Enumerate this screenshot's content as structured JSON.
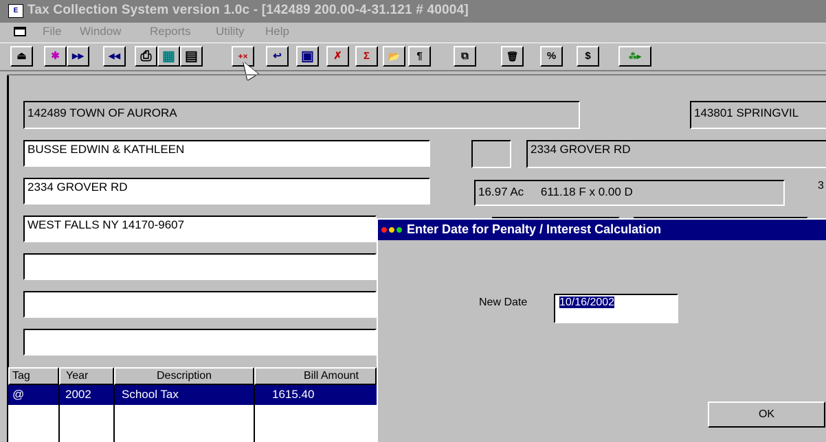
{
  "window": {
    "title": "Tax Collection System version 1.0c - [142489 200.00-4-31.121 # 40004]",
    "icon_label": "E"
  },
  "menu": {
    "items": [
      "File",
      "Window",
      "Reports",
      "Utility",
      "Help"
    ]
  },
  "toolbar": {
    "buttons": [
      {
        "icon": "open-icon",
        "glyph": "⏏"
      },
      {
        "icon": "magic-wand-icon",
        "glyph": "✱"
      },
      {
        "icon": "next-record-icon",
        "glyph": "▶▶"
      },
      {
        "icon": "previous-record-icon",
        "glyph": "◀◀"
      },
      {
        "icon": "print-icon",
        "glyph": "⎙"
      },
      {
        "icon": "grid-icon",
        "glyph": "▦"
      },
      {
        "icon": "list-icon",
        "glyph": "▤"
      },
      {
        "icon": "penalty-interest-icon",
        "glyph": "+×"
      },
      {
        "icon": "return-icon",
        "glyph": "↩"
      },
      {
        "icon": "screen-icon",
        "glyph": "▣"
      },
      {
        "icon": "strike-icon",
        "glyph": "✗"
      },
      {
        "icon": "sum-icon",
        "glyph": "Σ"
      },
      {
        "icon": "folder-icon",
        "glyph": "📂"
      },
      {
        "icon": "paragraph-icon",
        "glyph": "¶"
      },
      {
        "icon": "copy-icon",
        "glyph": "⧉"
      },
      {
        "icon": "trash-icon",
        "glyph": "🗑"
      },
      {
        "icon": "percent-icon",
        "glyph": "%"
      },
      {
        "icon": "dollar-icon",
        "glyph": "$"
      },
      {
        "icon": "tree-run-icon",
        "glyph": "⁂▸"
      }
    ]
  },
  "form": {
    "municipality": "142489 TOWN OF AURORA",
    "school_district": "143801 SPRINGVIL",
    "owner_name": "BUSSE EDWIN & KATHLEEN",
    "mail_address": "2334 GROVER RD",
    "city_state_zip": "WEST FALLS NY 14170-9607",
    "blank_line_1": "",
    "blank_line_2": "",
    "blank_line_3": "",
    "property_code": "",
    "property_location": "2334 GROVER RD",
    "acreage": "16.97 Ac",
    "dimensions": "611.18 F x 0.00 D",
    "edge_digit": "3"
  },
  "grid": {
    "columns": [
      "Tag",
      "Year",
      "Description",
      "Bill Amount"
    ],
    "rows": [
      {
        "tag": "@",
        "year": "2002",
        "description": "School Tax",
        "amount": "1615.40",
        "selected": true
      }
    ]
  },
  "dialog": {
    "title": "Enter Date for Penalty / Interest Calculation",
    "date_label": "New Date",
    "date_value": "10/16/2002",
    "ok_label": "OK"
  },
  "colors": {
    "face": "#c0c0c0",
    "selection": "#000080",
    "inactive_caption": "#808080"
  }
}
